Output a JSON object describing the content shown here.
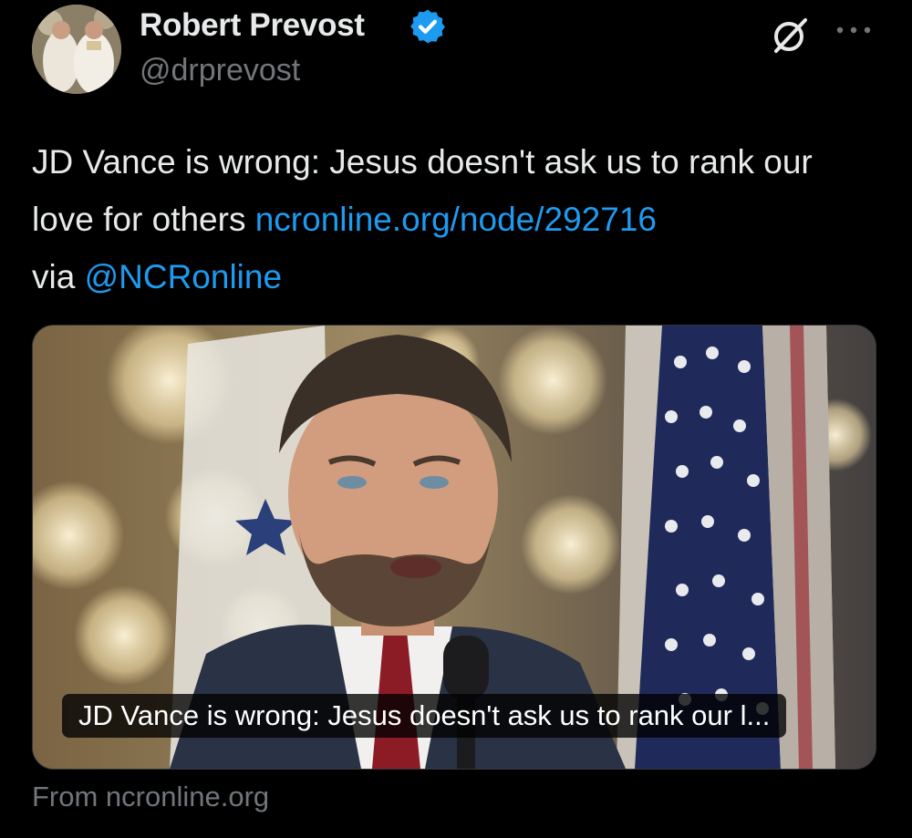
{
  "author": {
    "name": "Robert Prevost",
    "handle": "@drprevost",
    "verified": true,
    "verified_color": "#1d9bf0"
  },
  "tweet": {
    "text_before": "JD Vance is wrong: Jesus doesn't ask us to rank our love for others ",
    "link": "ncronline.org/node/292716",
    "via_prefix": "via ",
    "mention": "@NCRonline"
  },
  "card": {
    "caption": "JD Vance is wrong: Jesus doesn't ask us to rank our l...",
    "source": "From ncronline.org"
  },
  "icons": {
    "grok": "grok-icon",
    "more": "more-icon"
  },
  "colors": {
    "background": "#000000",
    "text": "#e7e9ea",
    "secondary": "#71767b",
    "link": "#1d9bf0"
  }
}
